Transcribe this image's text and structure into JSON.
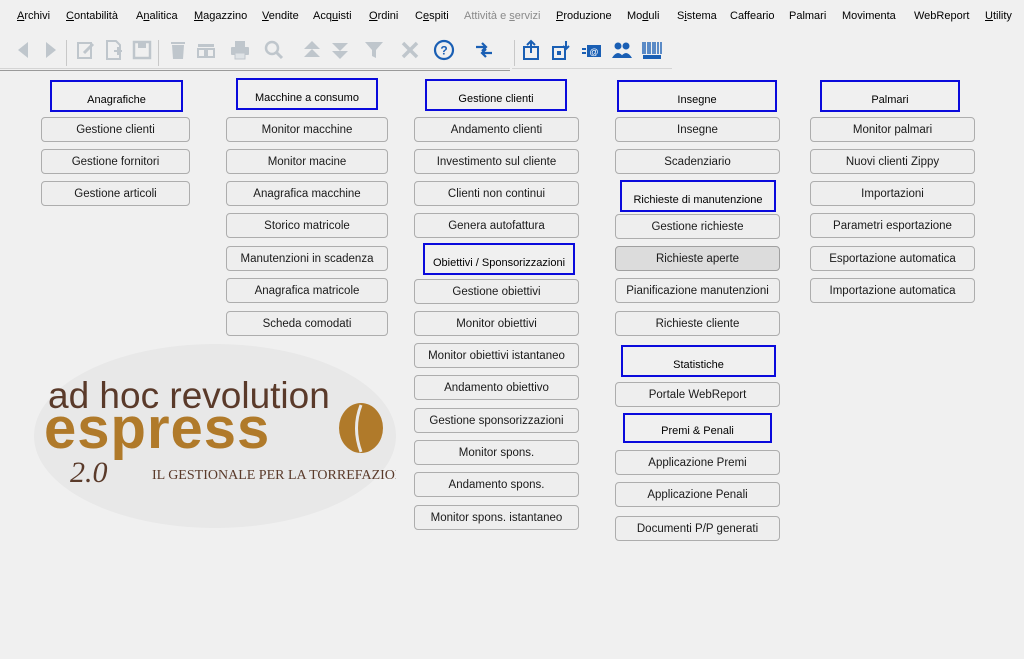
{
  "menu": [
    {
      "label": "Archivi",
      "ul": "A",
      "rest": "rchivi"
    },
    {
      "label": "Contabilità",
      "ul": "C",
      "rest": "ontabilità"
    },
    {
      "label": "Analitica",
      "pre": "A",
      "ul": "n",
      "rest": "alitica"
    },
    {
      "label": "Magazzino",
      "ul": "M",
      "rest": "agazzino"
    },
    {
      "label": "Vendite",
      "ul": "V",
      "rest": "endite"
    },
    {
      "label": "Acquisti",
      "pre": "Acq",
      "ul": "u",
      "rest": "isti"
    },
    {
      "label": "Ordini",
      "ul": "O",
      "rest": "rdini"
    },
    {
      "label": "Cespiti",
      "pre": "C",
      "ul": "e",
      "rest": "spiti"
    },
    {
      "label": "Attività e servizi",
      "pre": "Attività e ",
      "ul": "s",
      "rest": "ervizi",
      "disabled": true
    },
    {
      "label": "Produzione",
      "ul": "P",
      "rest": "roduzione"
    },
    {
      "label": "Moduli",
      "pre": "Mo",
      "ul": "d",
      "rest": "uli"
    },
    {
      "label": "Sistema",
      "pre": "S",
      "ul": "i",
      "rest": "stema"
    },
    {
      "label": "Caffeario",
      "ul": "",
      "rest": "Caffeario"
    },
    {
      "label": "Palmari",
      "ul": "",
      "rest": "Palmari"
    },
    {
      "label": "Movimenta",
      "ul": "",
      "rest": "Movimenta"
    },
    {
      "label": "WebReport",
      "ul": "",
      "rest": "WebReport"
    },
    {
      "label": "Utility",
      "ul": "U",
      "rest": "tility"
    }
  ],
  "toolbar_icons": [
    "back-arrow-icon",
    "forward-arrow-icon",
    "edit-icon",
    "new-record-icon",
    "save-icon",
    "delete-icon",
    "list-icon",
    "print-icon",
    "search-icon",
    "previous-record-icon",
    "next-record-icon",
    "filter-icon",
    "cancel-icon",
    "help-icon",
    "wizard-icon",
    "export-icon",
    "import-icon",
    "email-icon",
    "users-icon",
    "barcode-icon"
  ],
  "columns": {
    "anagrafiche": {
      "header": "Anagrafiche",
      "buttons": [
        "Gestione clienti",
        "Gestione fornitori",
        "Gestione articoli"
      ]
    },
    "macchine": {
      "header": "Macchine a consumo",
      "buttons": [
        "Monitor macchine",
        "Monitor macine",
        "Anagrafica macchine",
        "Storico matricole",
        "Manutenzioni in scadenza",
        "Anagrafica matricole",
        "Scheda comodati"
      ]
    },
    "clienti": {
      "header": "Gestione clienti",
      "buttons": [
        "Andamento clienti",
        "Investimento sul cliente",
        "Clienti non continui",
        "Genera autofattura"
      ]
    },
    "obiettivi": {
      "header": "Obiettivi / Sponsorizzazioni",
      "buttons": [
        "Gestione obiettivi",
        "Monitor obiettivi",
        "Monitor obiettivi istantaneo",
        "Andamento obiettivo",
        "Gestione sponsorizzazioni",
        "Monitor spons.",
        "Andamento spons.",
        "Monitor spons. istantaneo"
      ]
    },
    "insegne": {
      "header": "Insegne",
      "buttons": [
        "Insegne",
        "Scadenziario"
      ]
    },
    "manutenzione": {
      "header": "Richieste di manutenzione",
      "buttons": [
        "Gestione richieste",
        "Richieste aperte",
        "Pianificazione manutenzioni",
        "Richieste cliente"
      ]
    },
    "statistiche": {
      "header": "Statistiche",
      "buttons": [
        "Portale WebReport"
      ]
    },
    "premi": {
      "header": "Premi & Penali",
      "buttons": [
        "Applicazione Premi",
        "Applicazione Penali",
        "Documenti P/P generati"
      ]
    },
    "palmari": {
      "header": "Palmari",
      "buttons": [
        "Monitor palmari",
        "Nuovi clienti Zippy",
        "Importazioni",
        "Parametri esportazione",
        "Esportazione automatica",
        "Importazione automatica"
      ]
    }
  },
  "logo": {
    "line1": "ad hoc revolution",
    "line2": "espress",
    "version": "2.0",
    "tagline": "IL GESTIONALE PER LA TORREFAZIONE"
  },
  "colors": {
    "header_border": "#0a0adc",
    "logo_dark": "#5a3a2a",
    "logo_gold": "#b07a2a"
  }
}
